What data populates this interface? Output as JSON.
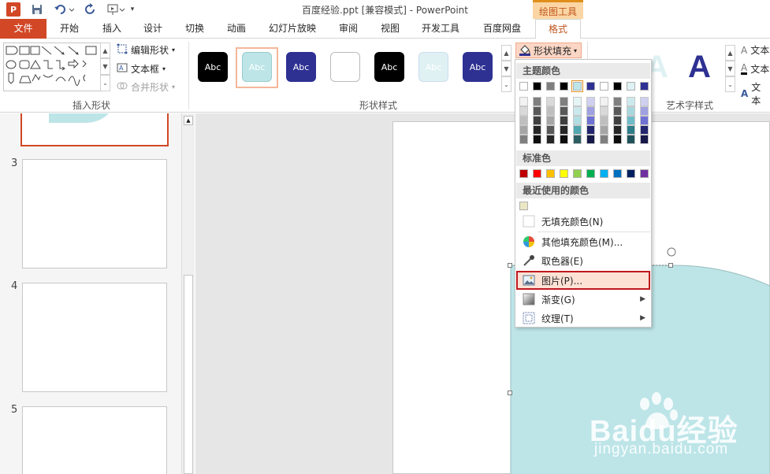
{
  "titlebar": {
    "app_logo": "P",
    "title": "百度经验.ppt [兼容模式] - PowerPoint",
    "context_group": "绘图工具"
  },
  "tabs": [
    {
      "label": "文件"
    },
    {
      "label": "开始"
    },
    {
      "label": "插入"
    },
    {
      "label": "设计"
    },
    {
      "label": "切换"
    },
    {
      "label": "动画"
    },
    {
      "label": "幻灯片放映"
    },
    {
      "label": "审阅"
    },
    {
      "label": "视图"
    },
    {
      "label": "开发工具"
    },
    {
      "label": "百度网盘"
    },
    {
      "label": "格式"
    }
  ],
  "ribbon": {
    "insert_shapes": {
      "label": "插入形状",
      "edit_shape": "编辑形状",
      "text_box": "文本框",
      "merge_shapes": "合并形状"
    },
    "shape_styles": {
      "label": "形状样式",
      "thumb_text": "Abc",
      "shape_fill": "形状填充"
    },
    "wordart": {
      "label": "艺术字样式",
      "letter": "A",
      "text_fill": "文本",
      "text_outline": "文本",
      "text_effects": "文本"
    }
  },
  "slides": [
    {
      "number": "3"
    },
    {
      "number": "4"
    },
    {
      "number": "5"
    }
  ],
  "fill_menu": {
    "theme_colors_header": "主题颜色",
    "standard_colors_header": "标准色",
    "recent_colors_header": "最近使用的颜色",
    "theme_top_row": [
      "#ffffff",
      "#000000",
      "#7f7f7f",
      "#000000",
      "#bde5e8",
      "#2e3192",
      "#ffffff",
      "#000000",
      "#dff1f3",
      "#2e3192"
    ],
    "standard_colors": [
      "#c00000",
      "#ff0000",
      "#ffc000",
      "#ffff00",
      "#92d050",
      "#00b050",
      "#00b0f0",
      "#0070c0",
      "#002060",
      "#7030a0"
    ],
    "recent_colors": [
      "#ebe6c4"
    ],
    "no_fill": "无填充颜色(N)",
    "more_colors": "其他填充颜色(M)...",
    "eyedropper": "取色器(E)",
    "picture": "图片(P)...",
    "gradient": "渐变(G)",
    "texture": "纹理(T)"
  },
  "watermark": {
    "brand": "Baidu经验",
    "url": "jingyan.baidu.com"
  }
}
